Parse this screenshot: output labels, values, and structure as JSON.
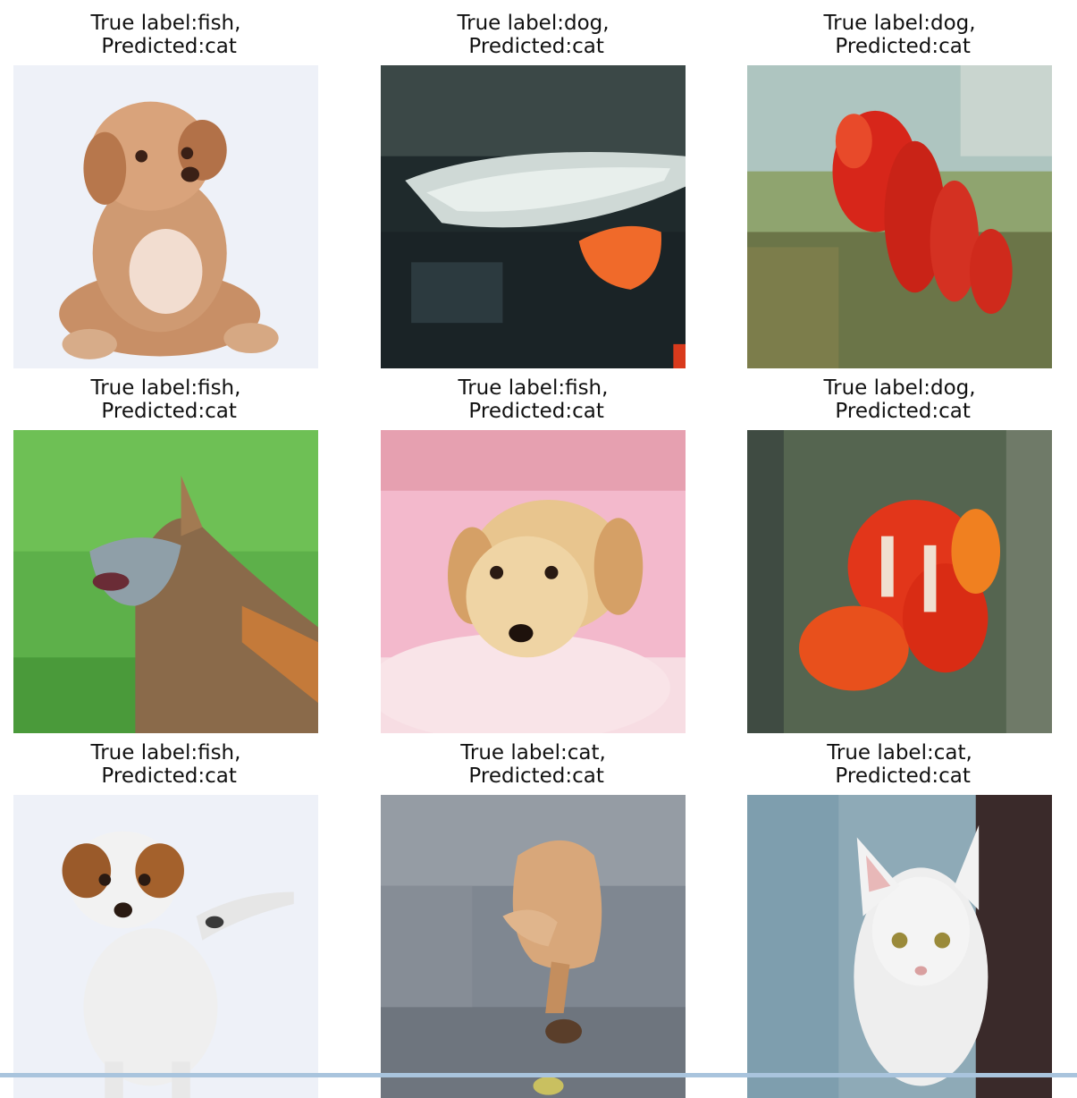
{
  "grid": {
    "cells": [
      {
        "true_label": "True label:fish,",
        "predicted": "Predicted:cat",
        "subject": "puppy on white background"
      },
      {
        "true_label": "True label:dog,",
        "predicted": "Predicted:cat",
        "subject": "silver fish with orange fin"
      },
      {
        "true_label": "True label:dog,",
        "predicted": "Predicted:cat",
        "subject": "red clownfish in grass"
      },
      {
        "true_label": "True label:fish,",
        "predicted": "Predicted:cat",
        "subject": "dog on green grass"
      },
      {
        "true_label": "True label:fish,",
        "predicted": "Predicted:cat",
        "subject": "puppy on pink blanket"
      },
      {
        "true_label": "True label:dog,",
        "predicted": "Predicted:cat",
        "subject": "orange clownfish"
      },
      {
        "true_label": "True label:fish,",
        "predicted": "Predicted:cat",
        "subject": "white and brown puppy"
      },
      {
        "true_label": "True label:cat,",
        "predicted": "Predicted:cat",
        "subject": "kitten on stone floor"
      },
      {
        "true_label": "True label:cat,",
        "predicted": "Predicted:cat",
        "subject": "white cat"
      }
    ]
  }
}
